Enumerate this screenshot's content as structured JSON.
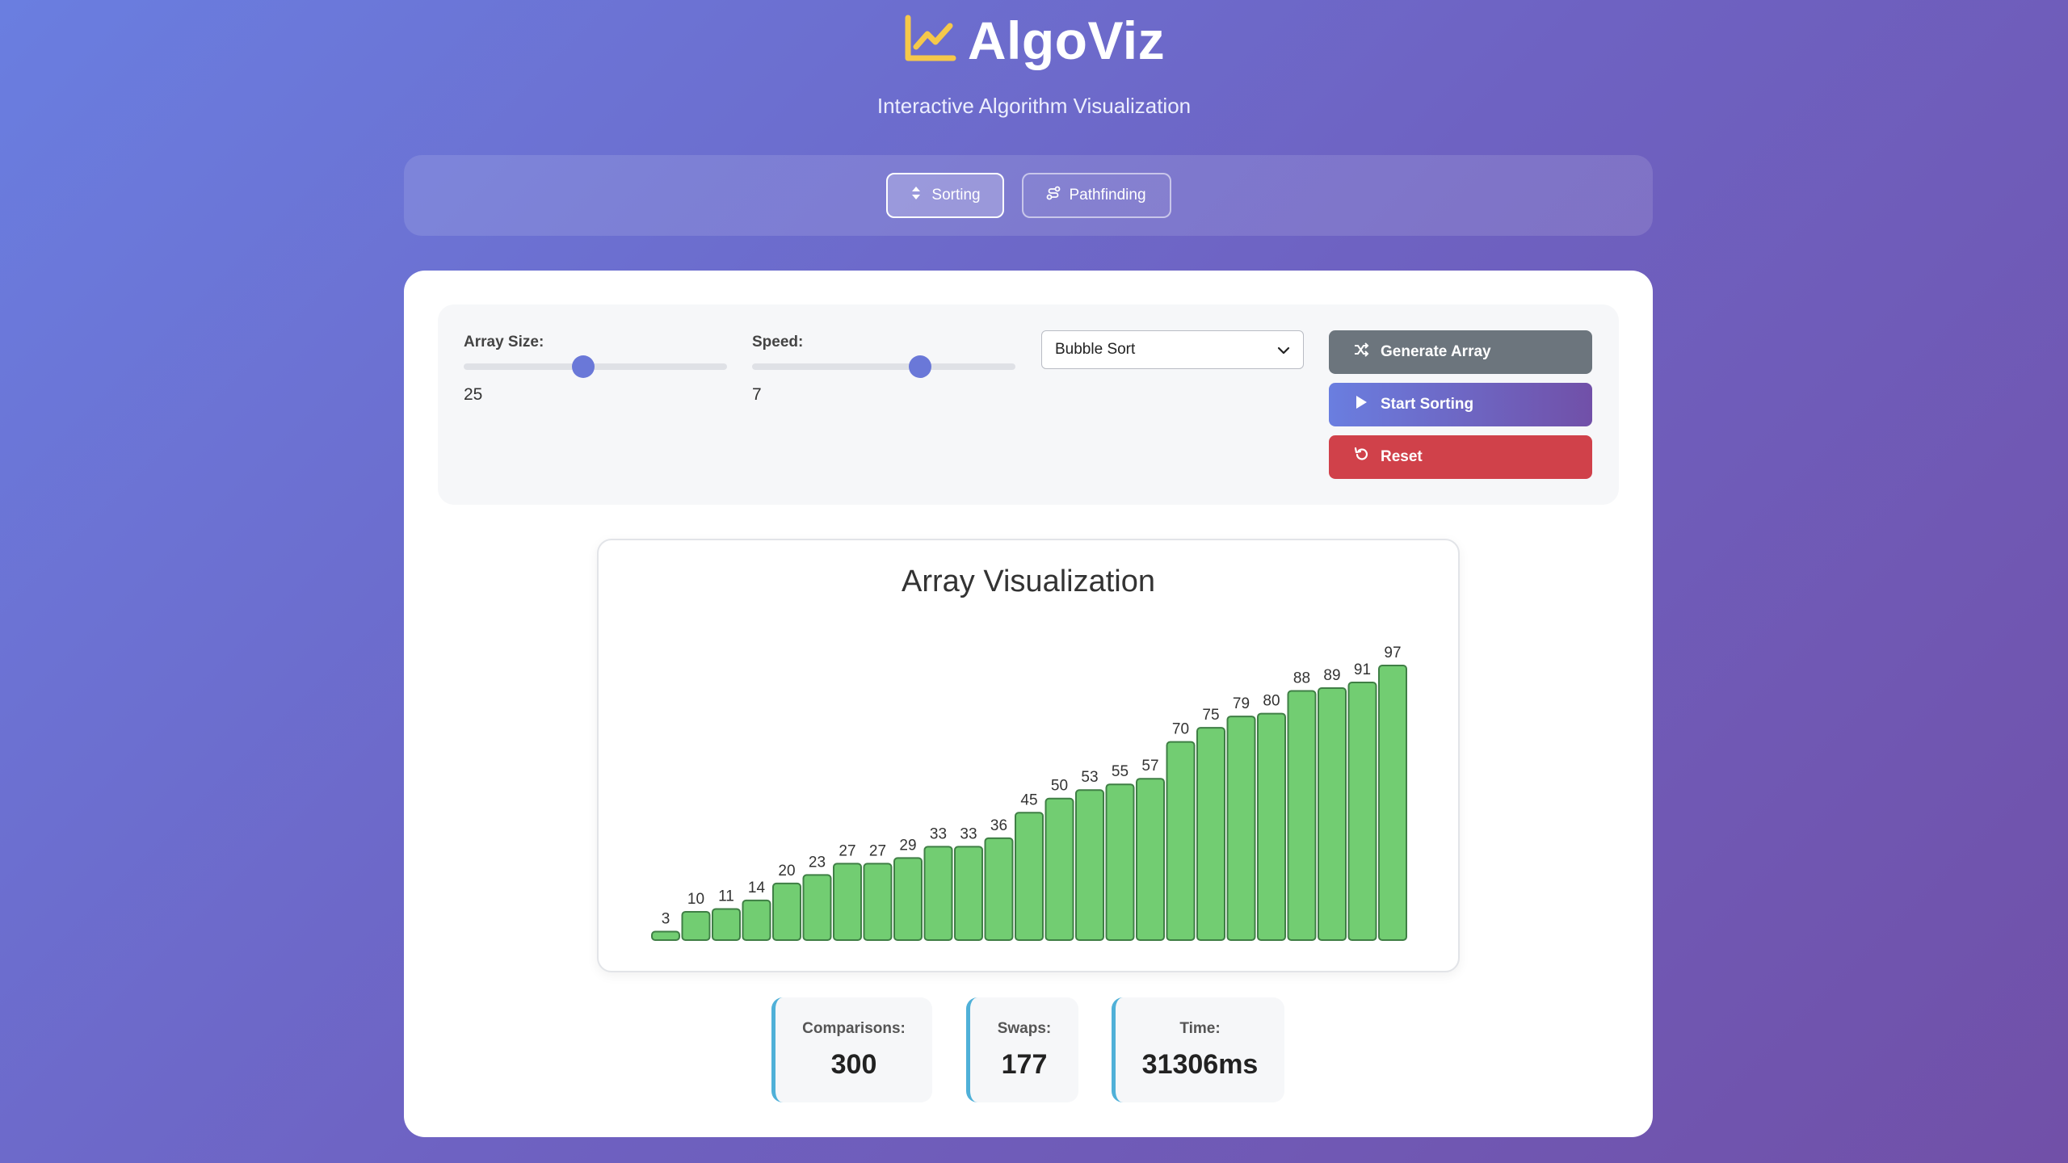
{
  "app": {
    "title": "AlgoViz",
    "subtitle": "Interactive Algorithm Visualization",
    "logo_icon": "chart-line-icon",
    "colors": {
      "logo": "#f5c84a",
      "accent": "#6a78d8",
      "bar_fill": "#72cd72",
      "reset": "#d0414a",
      "generate": "#6c757d",
      "stat_border": "#4fb0d8"
    }
  },
  "tabs": [
    {
      "label": "Sorting",
      "icon": "sort-icon",
      "active": true
    },
    {
      "label": "Pathfinding",
      "icon": "route-icon",
      "active": false
    }
  ],
  "controls": {
    "array_size": {
      "label": "Array Size:",
      "value": "25",
      "fraction": 0.45
    },
    "speed": {
      "label": "Speed:",
      "value": "7",
      "fraction": 0.65
    },
    "algorithm": {
      "selected": "Bubble Sort"
    },
    "buttons": {
      "generate": {
        "label": "Generate Array",
        "icon": "shuffle-icon"
      },
      "start": {
        "label": "Start Sorting",
        "icon": "play-icon"
      },
      "reset": {
        "label": "Reset",
        "icon": "undo-icon"
      }
    }
  },
  "visualization": {
    "title": "Array Visualization"
  },
  "chart_data": {
    "type": "bar",
    "title": "Array Visualization",
    "values": [
      3,
      10,
      11,
      14,
      20,
      23,
      27,
      27,
      29,
      33,
      33,
      36,
      45,
      50,
      53,
      55,
      57,
      70,
      75,
      79,
      80,
      88,
      89,
      91,
      97
    ],
    "xlabel": "",
    "ylabel": ""
  },
  "stats": {
    "comparisons": {
      "label": "Comparisons:",
      "value": "300"
    },
    "swaps": {
      "label": "Swaps:",
      "value": "177"
    },
    "time": {
      "label": "Time:",
      "value": "31306ms"
    }
  }
}
